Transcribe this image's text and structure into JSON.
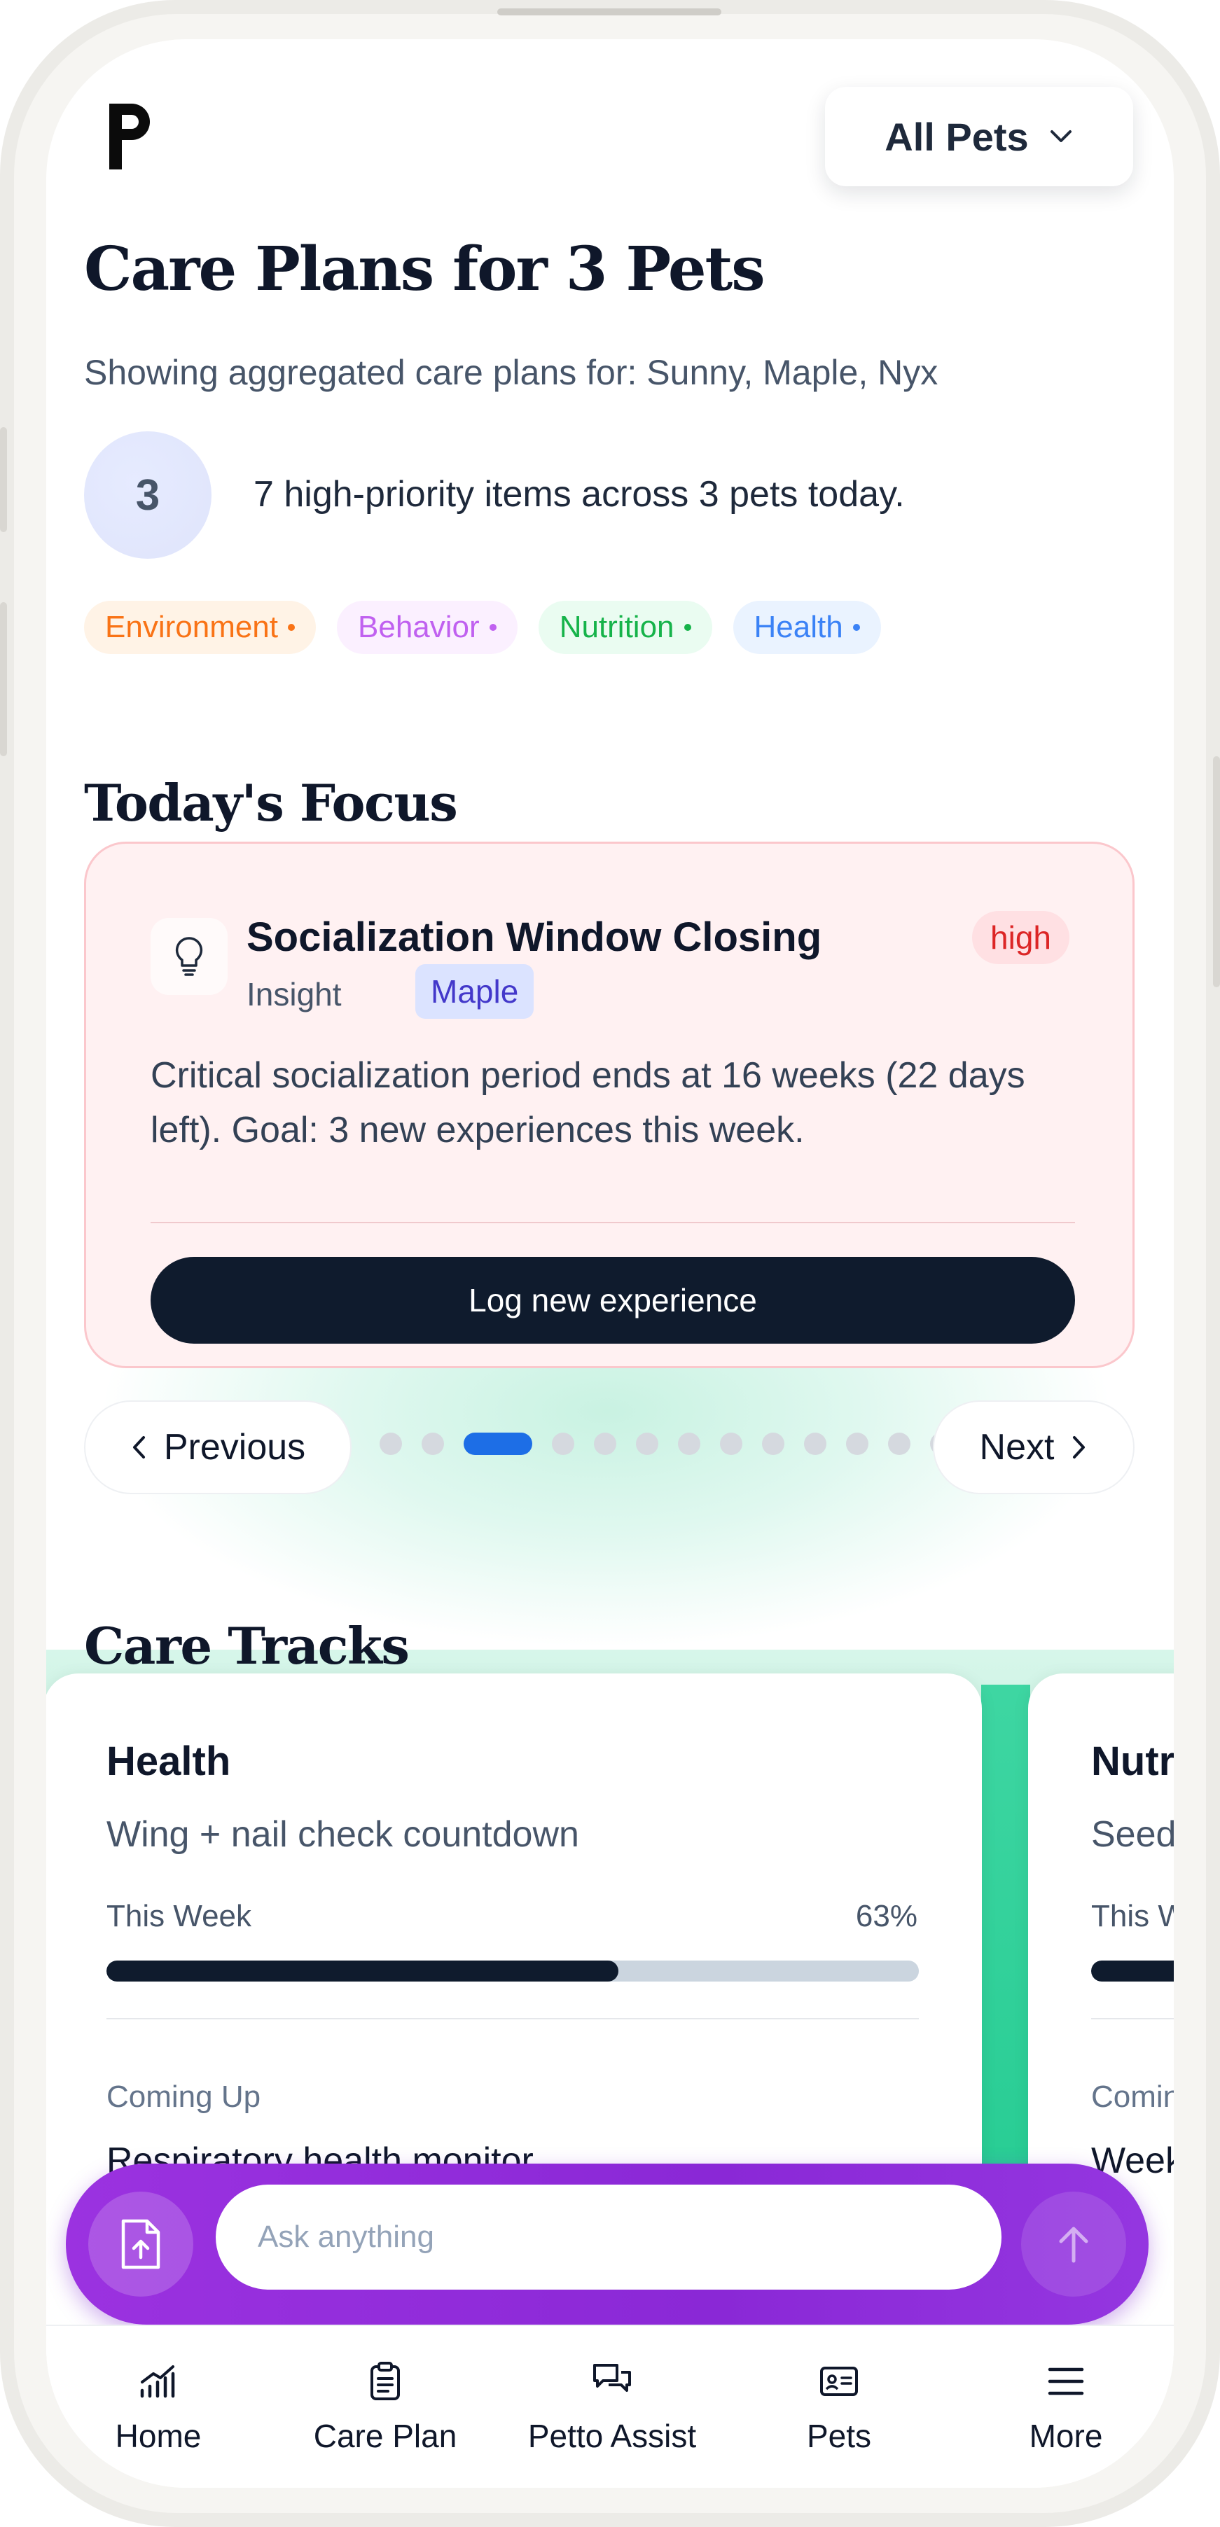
{
  "header": {
    "pets_filter": "All Pets"
  },
  "title": "Care Plans for 3 Pets",
  "subtitle": "Showing aggregated care plans for: Sunny, Maple, Nyx",
  "summary": {
    "count": "3",
    "text": "7 high-priority items across 3 pets today."
  },
  "tags": [
    {
      "label": "Environment",
      "color": "#f97316",
      "bg": "#fff3e6"
    },
    {
      "label": "Behavior",
      "color": "#c061f0",
      "bg": "#fbf0ff"
    },
    {
      "label": "Nutrition",
      "color": "#16b34a",
      "bg": "#eafcf1"
    },
    {
      "label": "Health",
      "color": "#3b82f6",
      "bg": "#eaf3ff"
    }
  ],
  "focus": {
    "heading": "Today's Focus",
    "card": {
      "title": "Socialization Window Closing",
      "priority": "high",
      "type": "Insight",
      "pet": "Maple",
      "description": "Critical socialization period ends at 16 weeks (22 days left). Goal: 3 new experiences this week.",
      "action": "Log new experience"
    },
    "pager": {
      "previous": "Previous",
      "next": "Next",
      "total": 13,
      "active_index": 2
    }
  },
  "tracks": {
    "heading": "Care Tracks",
    "cards": [
      {
        "title": "Health",
        "subtitle": "Wing + nail check countdown",
        "week_label": "This Week",
        "progress_pct": "63%",
        "progress": 0.63,
        "upcoming_label": "Coming Up",
        "upcoming": "Respiratory health monitor"
      },
      {
        "title": "Nutr",
        "subtitle": "Seed",
        "week_label": "This W",
        "progress_pct": "",
        "progress": 0.55,
        "upcoming_label": "Comin",
        "upcoming": "Week"
      }
    ]
  },
  "ask": {
    "placeholder": "Ask anything"
  },
  "nav": [
    {
      "label": "Home",
      "icon": "chart-icon"
    },
    {
      "label": "Care Plan",
      "icon": "clipboard-icon"
    },
    {
      "label": "Petto Assist",
      "icon": "chat-icon"
    },
    {
      "label": "Pets",
      "icon": "id-card-icon"
    },
    {
      "label": "More",
      "icon": "menu-icon"
    }
  ]
}
